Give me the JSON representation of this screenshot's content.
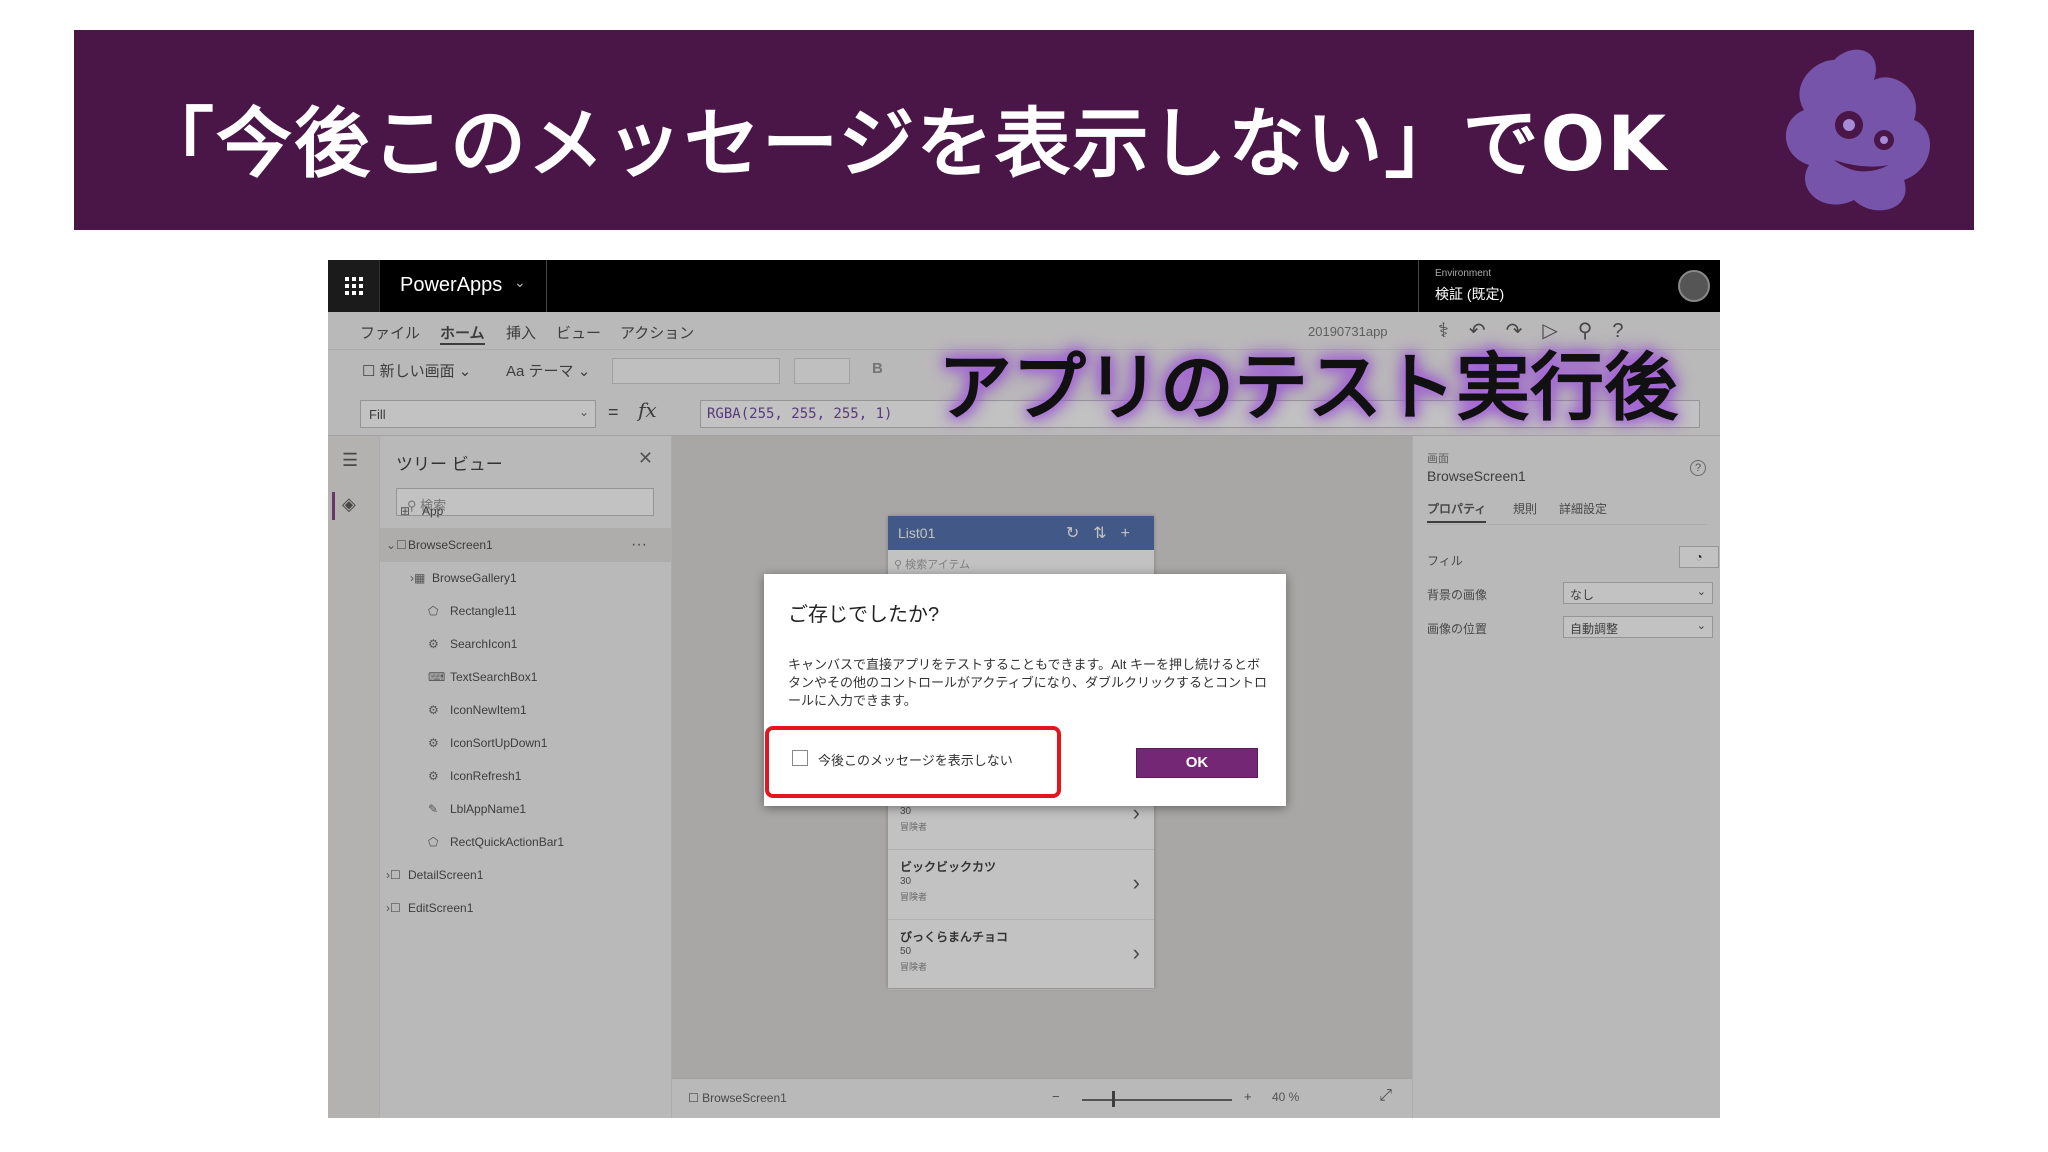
{
  "slide": {
    "title": "「今後このメッセージを表示しない」でOK",
    "caption": "アプリのテスト実行後"
  },
  "topbar": {
    "app_name": "PowerApps",
    "env_label": "Environment",
    "env_value": "検証 (既定)"
  },
  "menu": {
    "items": [
      "ファイル",
      "ホーム",
      "挿入",
      "ビュー",
      "アクション"
    ],
    "active": "ホーム",
    "app_file": "20190731app"
  },
  "ribbon": {
    "new_screen": "新しい画面",
    "theme": "テーマ",
    "bold": "B"
  },
  "formula": {
    "property": "Fill",
    "equals": "=",
    "fx": "fx",
    "expression": "RGBA(255, 255, 255, 1)"
  },
  "tree": {
    "title": "ツリー ビュー",
    "search_placeholder": "検索",
    "items": [
      {
        "label": "App",
        "icon": "app-icon"
      },
      {
        "label": "BrowseScreen1",
        "icon": "screen-icon"
      },
      {
        "label": "BrowseGallery1",
        "icon": "gallery-icon"
      },
      {
        "label": "Rectangle11",
        "icon": "shape-icon"
      },
      {
        "label": "SearchIcon1",
        "icon": "icon-icon"
      },
      {
        "label": "TextSearchBox1",
        "icon": "textbox-icon"
      },
      {
        "label": "IconNewItem1",
        "icon": "icon-icon"
      },
      {
        "label": "IconSortUpDown1",
        "icon": "icon-icon"
      },
      {
        "label": "IconRefresh1",
        "icon": "icon-icon"
      },
      {
        "label": "LblAppName1",
        "icon": "label-icon"
      },
      {
        "label": "RectQuickActionBar1",
        "icon": "shape-icon"
      },
      {
        "label": "DetailScreen1",
        "icon": "screen-icon"
      },
      {
        "label": "EditScreen1",
        "icon": "screen-icon"
      }
    ]
  },
  "phone": {
    "header": "List01",
    "search": "検索アイテム",
    "rows": [
      {
        "title": "",
        "num": "30",
        "sub": "冒険者"
      },
      {
        "title": "ビックビックカツ",
        "num": "30",
        "sub": "冒険者"
      },
      {
        "title": "びっくらまんチョコ",
        "num": "50",
        "sub": "冒険者"
      }
    ]
  },
  "statusbar": {
    "screen": "BrowseScreen1",
    "zoom_pct": "40 %"
  },
  "rpanel": {
    "kind": "画面",
    "name": "BrowseScreen1",
    "tabs": [
      "プロパティ",
      "規則",
      "詳細設定"
    ],
    "fill_label": "フィル",
    "bg_image_label": "背景の画像",
    "bg_image_value": "なし",
    "img_pos_label": "画像の位置",
    "img_pos_value": "自動調整"
  },
  "dialog": {
    "title": "ご存じでしたか?",
    "body": "キャンバスで直接アプリをテストすることもできます。Alt キーを押し続けるとボタンやその他のコントロールがアクティブになり、ダブルクリックするとコントロールに入力できます。",
    "checkbox_label": "今後このメッセージを表示しない",
    "checkbox_checked": false,
    "ok_label": "OK"
  },
  "colors": {
    "banner": "#4a1547",
    "accent": "#742774",
    "highlight": "#e6141e"
  }
}
